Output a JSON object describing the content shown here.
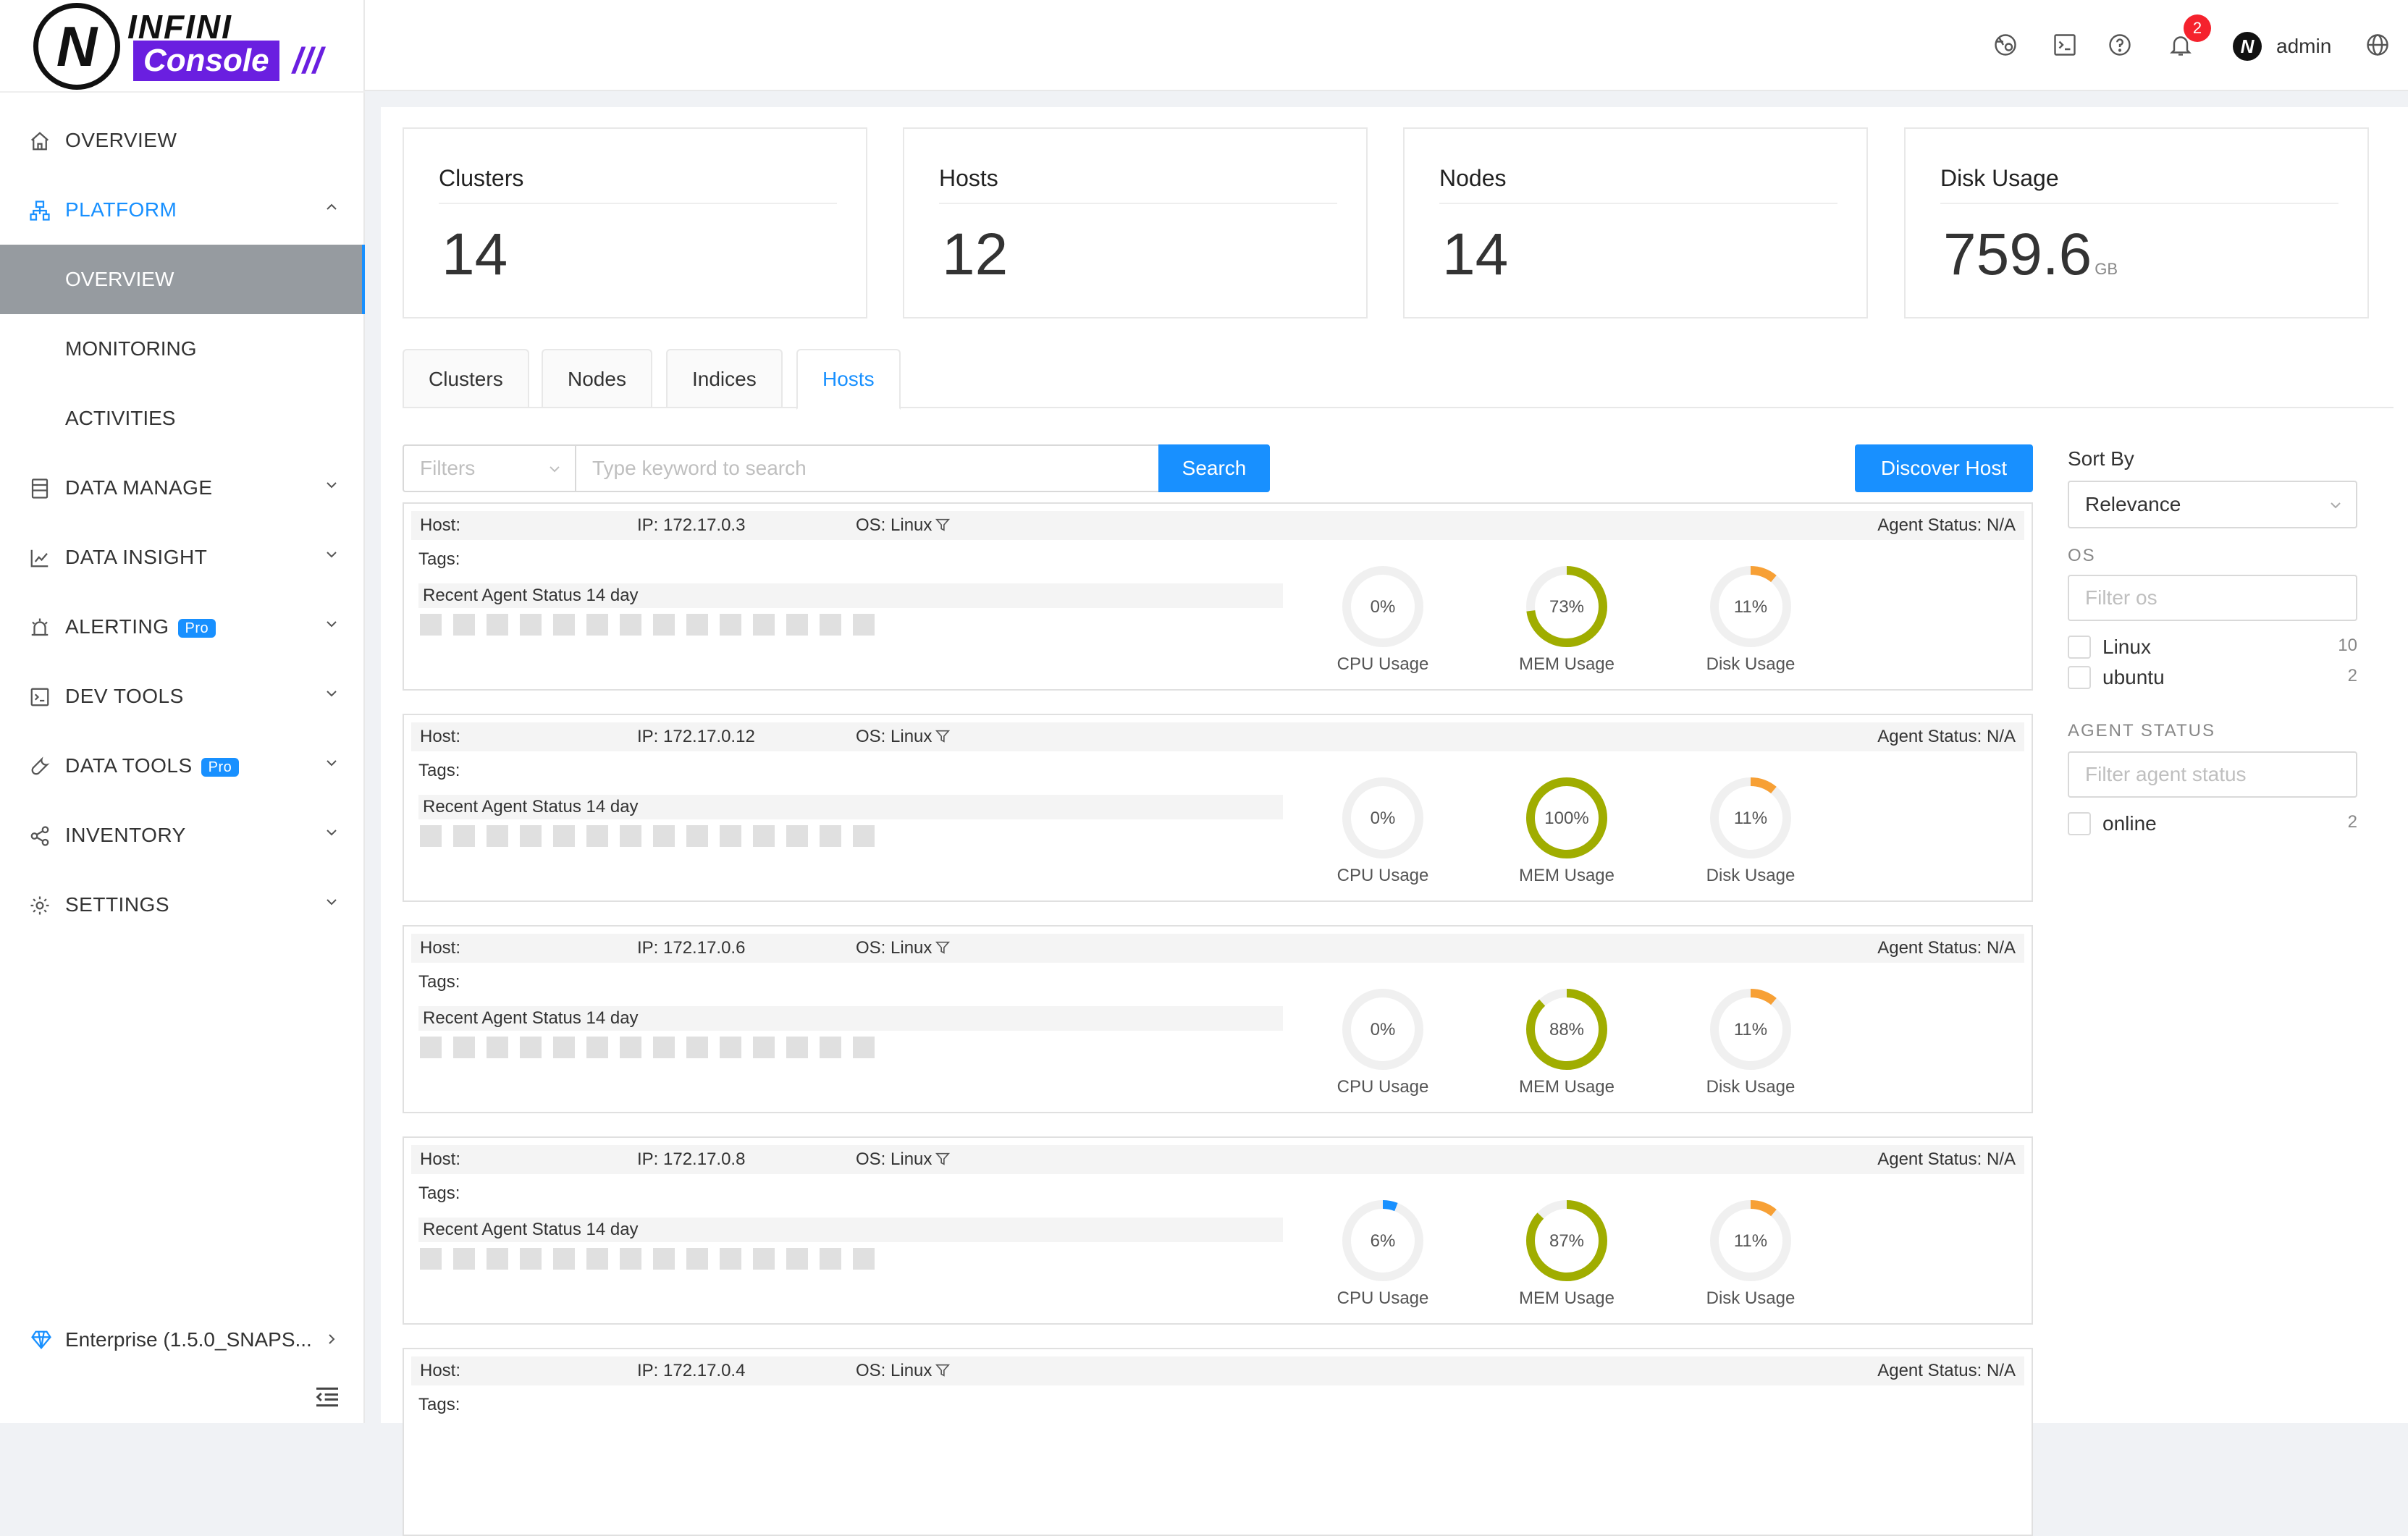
{
  "brand": {
    "word1": "INFINI",
    "word2": "Console",
    "mark": "N"
  },
  "sidebar": {
    "items": [
      {
        "label": "OVERVIEW",
        "icon": "home-icon"
      },
      {
        "label": "PLATFORM",
        "icon": "sitemap-icon"
      },
      {
        "label": "OVERVIEW"
      },
      {
        "label": "MONITORING"
      },
      {
        "label": "ACTIVITIES"
      },
      {
        "label": "DATA MANAGE",
        "icon": "database-icon"
      },
      {
        "label": "DATA INSIGHT",
        "icon": "chart-icon"
      },
      {
        "label": "ALERTING",
        "icon": "alarm-icon",
        "badge": "Pro"
      },
      {
        "label": "DEV TOOLS",
        "icon": "terminal-icon"
      },
      {
        "label": "DATA TOOLS",
        "icon": "wrench-icon",
        "badge": "Pro"
      },
      {
        "label": "INVENTORY",
        "icon": "share-icon"
      },
      {
        "label": "SETTINGS",
        "icon": "gear-icon"
      }
    ],
    "enterprise": "Enterprise (1.5.0_SNAPS..."
  },
  "header": {
    "notifications": "2",
    "user": "admin"
  },
  "stats": [
    {
      "title": "Clusters",
      "value": "14",
      "unit": ""
    },
    {
      "title": "Hosts",
      "value": "12",
      "unit": ""
    },
    {
      "title": "Nodes",
      "value": "14",
      "unit": ""
    },
    {
      "title": "Disk Usage",
      "value": "759.6",
      "unit": "GB"
    }
  ],
  "tabs": [
    "Clusters",
    "Nodes",
    "Indices",
    "Hosts"
  ],
  "search": {
    "filters_placeholder": "Filters",
    "placeholder": "Type keyword to search",
    "button": "Search",
    "discover": "Discover Host"
  },
  "host_labels": {
    "host": "Host:",
    "tags": "Tags:",
    "recent": "Recent Agent Status 14 day",
    "cpu": "CPU Usage",
    "mem": "MEM Usage",
    "disk": "Disk Usage"
  },
  "hosts": [
    {
      "ip": "IP: 172.17.0.3",
      "os": "OS: Linux",
      "agent": "Agent Status:  N/A",
      "cpu": 0,
      "cpu_label": "0%",
      "mem": 73,
      "mem_label": "73%",
      "disk": 11,
      "disk_label": "11%"
    },
    {
      "ip": "IP: 172.17.0.12",
      "os": "OS: Linux",
      "agent": "Agent Status:  N/A",
      "cpu": 0,
      "cpu_label": "0%",
      "mem": 100,
      "mem_label": "100%",
      "disk": 11,
      "disk_label": "11%"
    },
    {
      "ip": "IP: 172.17.0.6",
      "os": "OS: Linux",
      "agent": "Agent Status:  N/A",
      "cpu": 0,
      "cpu_label": "0%",
      "mem": 88,
      "mem_label": "88%",
      "disk": 11,
      "disk_label": "11%"
    },
    {
      "ip": "IP: 172.17.0.8",
      "os": "OS: Linux",
      "agent": "Agent Status:  N/A",
      "cpu": 6,
      "cpu_label": "6%",
      "mem": 87,
      "mem_label": "87%",
      "disk": 11,
      "disk_label": "11%"
    },
    {
      "ip": "IP: 172.17.0.4",
      "os": "OS: Linux",
      "agent": "Agent Status:  N/A"
    }
  ],
  "panel": {
    "sort_by": "Sort By",
    "sort_value": "Relevance",
    "os_heading": "OS",
    "os_placeholder": "Filter os",
    "os_options": [
      {
        "label": "Linux",
        "count": "10"
      },
      {
        "label": "ubuntu",
        "count": "2"
      }
    ],
    "agent_heading": "AGENT STATUS",
    "agent_placeholder": "Filter agent status",
    "agent_options": [
      {
        "label": "online",
        "count": "2"
      }
    ]
  },
  "colors": {
    "accent": "#1890ff",
    "mem_gauge": "#a0ad00",
    "disk_gauge": "#f7a035",
    "cpu_gauge": "#1890ff",
    "gauge_track": "#f0f0f0",
    "brand_purple": "#6a1fe0"
  }
}
